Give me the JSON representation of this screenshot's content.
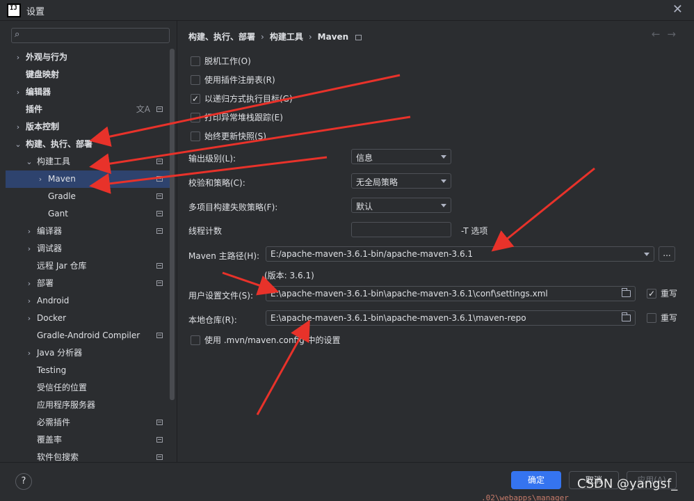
{
  "window": {
    "title": "设置",
    "logo_text": "IJ"
  },
  "sidebar": {
    "search_placeholder": "",
    "items": [
      {
        "label": "外观与行为",
        "level": 0,
        "expander": "›",
        "bold": true
      },
      {
        "label": "键盘映射",
        "level": 0,
        "expander": "",
        "bold": true
      },
      {
        "label": "编辑器",
        "level": 0,
        "expander": "›",
        "bold": true
      },
      {
        "label": "插件",
        "level": 0,
        "expander": "",
        "bold": true,
        "translate": "文A",
        "mark": true
      },
      {
        "label": "版本控制",
        "level": 0,
        "expander": "›",
        "bold": true
      },
      {
        "label": "构建、执行、部署",
        "level": 0,
        "expander": "⌄",
        "bold": true
      },
      {
        "label": "构建工具",
        "level": 1,
        "expander": "⌄",
        "mark": true
      },
      {
        "label": "Maven",
        "level": 2,
        "expander": "›",
        "mark": true,
        "selected": true
      },
      {
        "label": "Gradle",
        "level": 2,
        "expander": "",
        "mark": true
      },
      {
        "label": "Gant",
        "level": 2,
        "expander": "",
        "mark": true
      },
      {
        "label": "编译器",
        "level": 1,
        "expander": "›",
        "mark": true
      },
      {
        "label": "调试器",
        "level": 1,
        "expander": "›"
      },
      {
        "label": "远程 Jar 仓库",
        "level": 1,
        "expander": "",
        "mark": true
      },
      {
        "label": "部署",
        "level": 1,
        "expander": "›",
        "mark": true
      },
      {
        "label": "Android",
        "level": 1,
        "expander": "›"
      },
      {
        "label": "Docker",
        "level": 1,
        "expander": "›"
      },
      {
        "label": "Gradle-Android Compiler",
        "level": 1,
        "expander": "",
        "mark": true
      },
      {
        "label": "Java 分析器",
        "level": 1,
        "expander": "›"
      },
      {
        "label": "Testing",
        "level": 1,
        "expander": ""
      },
      {
        "label": "受信任的位置",
        "level": 1,
        "expander": ""
      },
      {
        "label": "应用程序服务器",
        "level": 1,
        "expander": ""
      },
      {
        "label": "必需插件",
        "level": 1,
        "expander": "",
        "mark": true
      },
      {
        "label": "覆盖率",
        "level": 1,
        "expander": "",
        "mark": true
      },
      {
        "label": "软件包搜索",
        "level": 1,
        "expander": "",
        "mark": true
      }
    ]
  },
  "breadcrumb": {
    "part1": "构建、执行、部署",
    "part2": "构建工具",
    "part3": "Maven",
    "sep": "›"
  },
  "nav": {
    "back": "←",
    "forward": "→"
  },
  "checkboxes": {
    "offline": {
      "label": "脱机工作(O)",
      "checked": false
    },
    "plugin_registry": {
      "label": "使用插件注册表(R)",
      "checked": false
    },
    "recursive": {
      "label": "以递归方式执行目标(G)",
      "checked": true
    },
    "stacktrace": {
      "label": "打印异常堆栈跟踪(E)",
      "checked": false
    },
    "always_update": {
      "label": "始终更新快照(S)",
      "checked": false
    },
    "mvn_config": {
      "label": "使用 .mvn/maven.config 中的设置",
      "checked": false
    }
  },
  "output_level": {
    "label": "输出级别(L):",
    "value": "信息"
  },
  "checksum": {
    "label": "校验和策略(C):",
    "value": "无全局策略"
  },
  "fail_policy": {
    "label": "多项目构建失败策略(F):",
    "value": "默认"
  },
  "threads": {
    "label": "线程计数",
    "value": "",
    "hint": "-T 选项"
  },
  "maven_home": {
    "label": "Maven 主路径(H):",
    "value": "E:/apache-maven-3.6.1-bin/apache-maven-3.6.1",
    "browse": "...",
    "version": "(版本: 3.6.1)"
  },
  "user_settings": {
    "label": "用户设置文件(S):",
    "value": "E:\\apache-maven-3.6.1-bin\\apache-maven-3.6.1\\conf\\settings.xml",
    "override_label": "重写",
    "override": true
  },
  "local_repo": {
    "label": "本地仓库(R):",
    "value": "E:\\apache-maven-3.6.1-bin\\apache-maven-3.6.1\\maven-repo",
    "override_label": "重写",
    "override": false
  },
  "footer": {
    "help": "?",
    "ok": "确定",
    "cancel": "取消",
    "apply": "应用(A)"
  },
  "watermark": "CSDN @yangsf_",
  "background_code": ".02\\webapps\\manager"
}
